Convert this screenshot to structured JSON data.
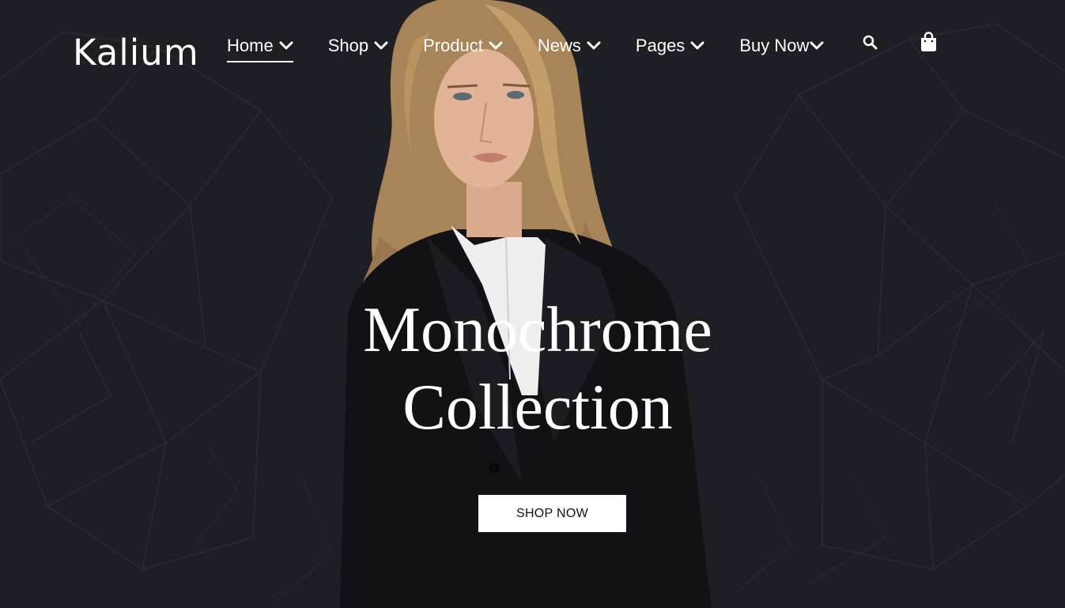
{
  "header": {
    "logo": "Kalium",
    "nav": [
      {
        "label": "Home",
        "active": true
      },
      {
        "label": "Shop",
        "active": false
      },
      {
        "label": "Product",
        "active": false
      },
      {
        "label": "News",
        "active": false
      },
      {
        "label": "Pages",
        "active": false
      },
      {
        "label": "Buy Now",
        "active": false
      }
    ],
    "icons": [
      "search-icon",
      "shopping-bag-icon"
    ]
  },
  "hero": {
    "headline_line1": "Monochrome",
    "headline_line2": "Collection",
    "cta_label": "SHOP NOW"
  },
  "colors": {
    "background": "#1e1f25",
    "text": "#ffffff",
    "button_bg": "#ffffff",
    "button_text": "#111111"
  }
}
